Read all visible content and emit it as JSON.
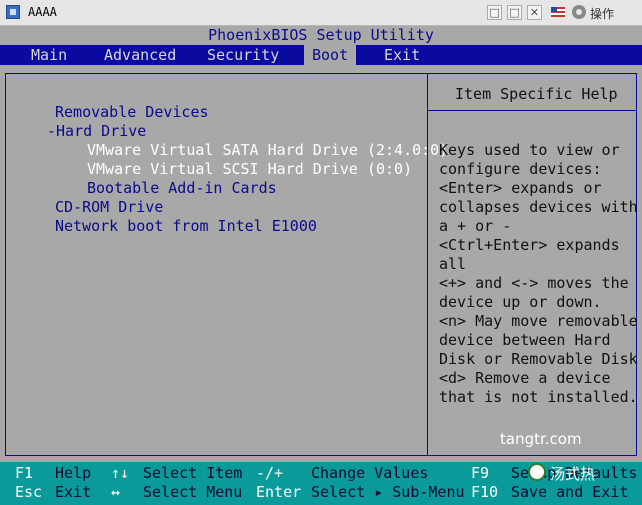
{
  "window": {
    "title": "AAAA",
    "ops_label": "操作",
    "controls": [
      "□",
      "□",
      "✕"
    ]
  },
  "bios": {
    "title": "PhoenixBIOS Setup Utility",
    "tabs": [
      "Main",
      "Advanced",
      "Security",
      "Boot",
      "Exit"
    ],
    "active_tab": "Boot",
    "boot_items": [
      "Removable Devices",
      "-Hard Drive",
      "VMware Virtual SATA Hard Drive (2:4.0:0)",
      "VMware Virtual SCSI Hard Drive (0:0)",
      "Bootable Add-in Cards",
      "CD-ROM Drive",
      "Network boot from Intel E1000"
    ],
    "help_title": "Item Specific Help",
    "help_lines": [
      "Keys used to view or",
      "configure devices:",
      "<Enter> expands or",
      "collapses devices with",
      "a + or -",
      "<Ctrl+Enter> expands",
      "all",
      "<+> and <-> moves the",
      "device up or down.",
      "<n> May move removable",
      "device between Hard",
      "Disk or Removable Disk",
      "<d> Remove a device",
      "that is not installed."
    ],
    "watermark_site": "tangtr.com",
    "keys_row1": {
      "k1": "F1",
      "d1": "Help",
      "k2": "↑↓",
      "d2": "Select Item",
      "k3": "-/+",
      "d3": "Change Values",
      "k4": "F9",
      "d4": "Setup Defaults"
    },
    "keys_row2": {
      "k1": "Esc",
      "d1": "Exit",
      "k2": "↔",
      "d2": "Select Menu",
      "k3": "Enter",
      "d3": "Select ▸ Sub-Menu",
      "k4": "F10",
      "d4": "Save and Exit"
    },
    "watermark_wechat": "汤式热"
  },
  "colors": {
    "bios_blue": "#0a0aa0",
    "bios_gray": "#a8a8a8",
    "keybar_teal": "#0a9a9a"
  }
}
